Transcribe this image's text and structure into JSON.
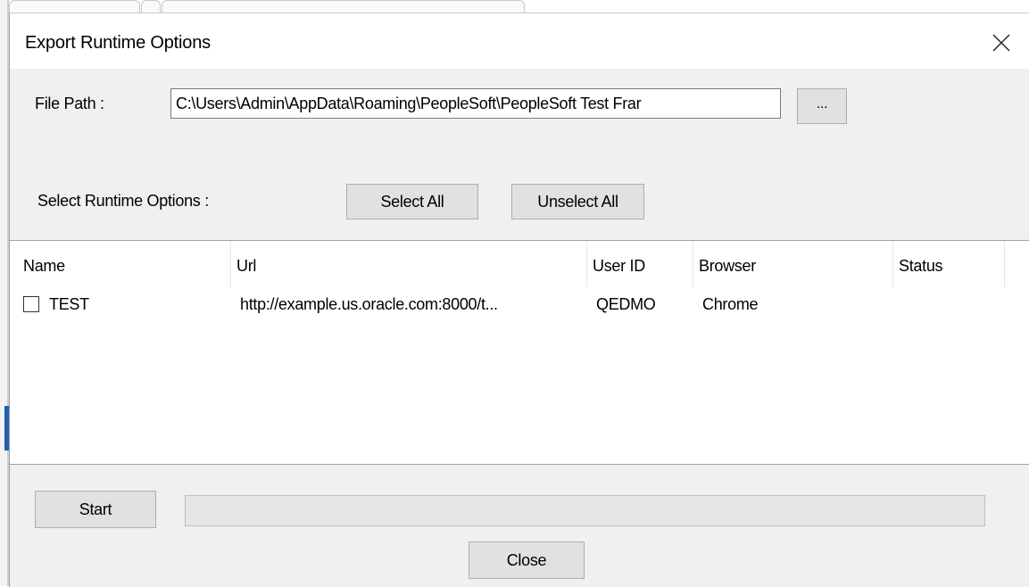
{
  "dialog": {
    "title": "Export Runtime Options",
    "file_path_label": "File Path :",
    "file_path_value": "C:\\Users\\Admin\\AppData\\Roaming\\PeopleSoft\\PeopleSoft Test Frar",
    "browse_label": "...",
    "select_runtime_label": "Select Runtime Options :",
    "select_all_label": "Select All",
    "unselect_all_label": "Unselect All",
    "start_label": "Start",
    "close_label": "Close",
    "progress": 0
  },
  "table": {
    "columns": [
      "Name",
      "Url",
      "User ID",
      "Browser",
      "Status"
    ],
    "rows": [
      {
        "checked": false,
        "name": "TEST",
        "url": "http://example.us.oracle.com:8000/t...",
        "user_id": "QEDMO",
        "browser": "Chrome",
        "status": ""
      }
    ]
  },
  "icons": {
    "close": "close-icon",
    "checkbox": "checkbox-unchecked"
  },
  "colors": {
    "dialog_bg": "#f0f0f0",
    "button_bg": "#e1e1e1",
    "progress_fill": "#06b025"
  }
}
